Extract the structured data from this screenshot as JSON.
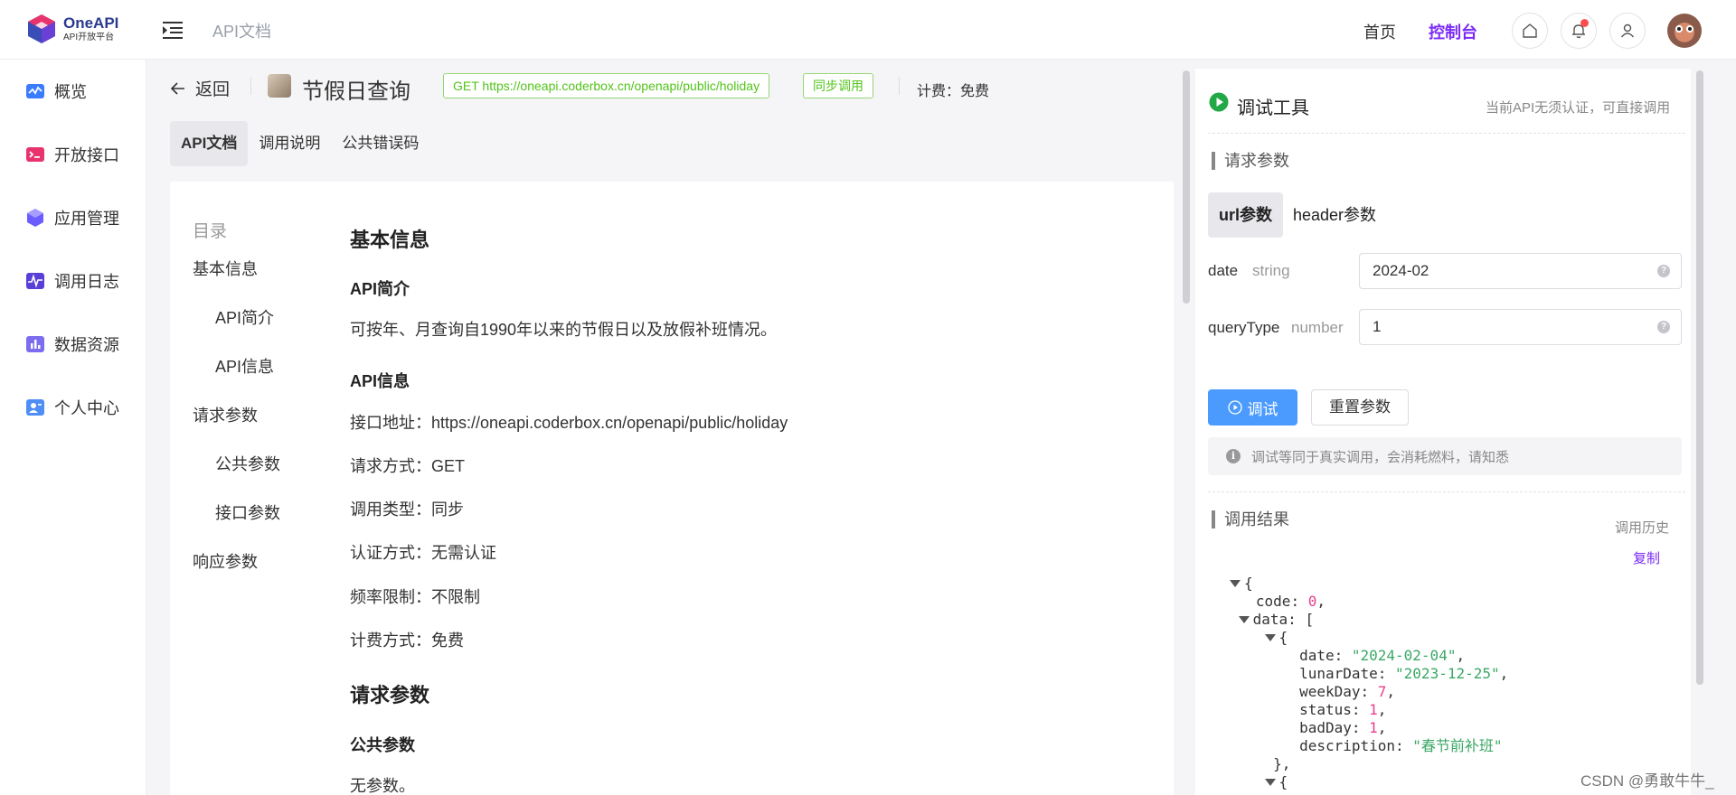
{
  "header": {
    "logo_title": "OneAPI",
    "logo_subtitle": "API开放平台",
    "breadcrumb": "API文档",
    "nav_home": "首页",
    "nav_console": "控制台",
    "icons": [
      "home-icon",
      "bell-icon",
      "user-icon"
    ]
  },
  "sidebar": {
    "items": [
      {
        "label": "概览",
        "icon": "chart-line-icon",
        "color": "#3b7cff"
      },
      {
        "label": "开放接口",
        "icon": "terminal-icon",
        "color": "#e8336d"
      },
      {
        "label": "应用管理",
        "icon": "cube-icon",
        "color": "#6a5cff"
      },
      {
        "label": "调用日志",
        "icon": "activity-icon",
        "color": "#5a3fd6"
      },
      {
        "label": "数据资源",
        "icon": "bar-chart-icon",
        "color": "#7c6cf0"
      },
      {
        "label": "个人中心",
        "icon": "user-card-icon",
        "color": "#4f8ef7"
      }
    ]
  },
  "doc": {
    "back_label": "返回",
    "title": "节假日查询",
    "endpoint_tag": "GET https://oneapi.coderbox.cn/openapi/public/holiday",
    "mode_tag": "同步调用",
    "billing": "计费：免费",
    "tabs": [
      "API文档",
      "调用说明",
      "公共错误码"
    ],
    "toc": {
      "title": "目录",
      "items": [
        "基本信息",
        "API简介",
        "API信息",
        "请求参数",
        "公共参数",
        "接口参数",
        "响应参数"
      ]
    },
    "content": {
      "h_basic": "基本信息",
      "h_intro": "API简介",
      "intro": "可按年、月查询自1990年以来的节假日以及放假补班情况。",
      "h_info": "API信息",
      "url_line": "接口地址：https://oneapi.coderbox.cn/openapi/public/holiday",
      "method_line": "请求方式：GET",
      "type_line": "调用类型：同步",
      "auth_line": "认证方式：无需认证",
      "rate_line": "频率限制：不限制",
      "bill_line": "计费方式：免费",
      "h_params": "请求参数",
      "h_public": "公共参数",
      "public_none": "无参数。"
    }
  },
  "debug": {
    "title": "调试工具",
    "note": "当前API无须认证，可直接调用",
    "section_params": "请求参数",
    "param_tabs": [
      "url参数",
      "header参数"
    ],
    "params": [
      {
        "name": "date",
        "type": "string",
        "value": "2024-02"
      },
      {
        "name": "queryType",
        "type": "number",
        "value": "1"
      }
    ],
    "test_button": "调试",
    "reset_button": "重置参数",
    "alert": "调试等同于真实调用，会消耗燃料，请知悉",
    "section_result": "调用结果",
    "history": "调用历史",
    "copy": "复制",
    "result": {
      "code": "0",
      "item": {
        "date": "\"2024-02-04\"",
        "lunarDate": "\"2023-12-25\"",
        "weekDay": "7",
        "status": "1",
        "badDay": "1",
        "description": "\"春节前补班\""
      }
    }
  },
  "watermark": "CSDN @勇敢牛牛_"
}
